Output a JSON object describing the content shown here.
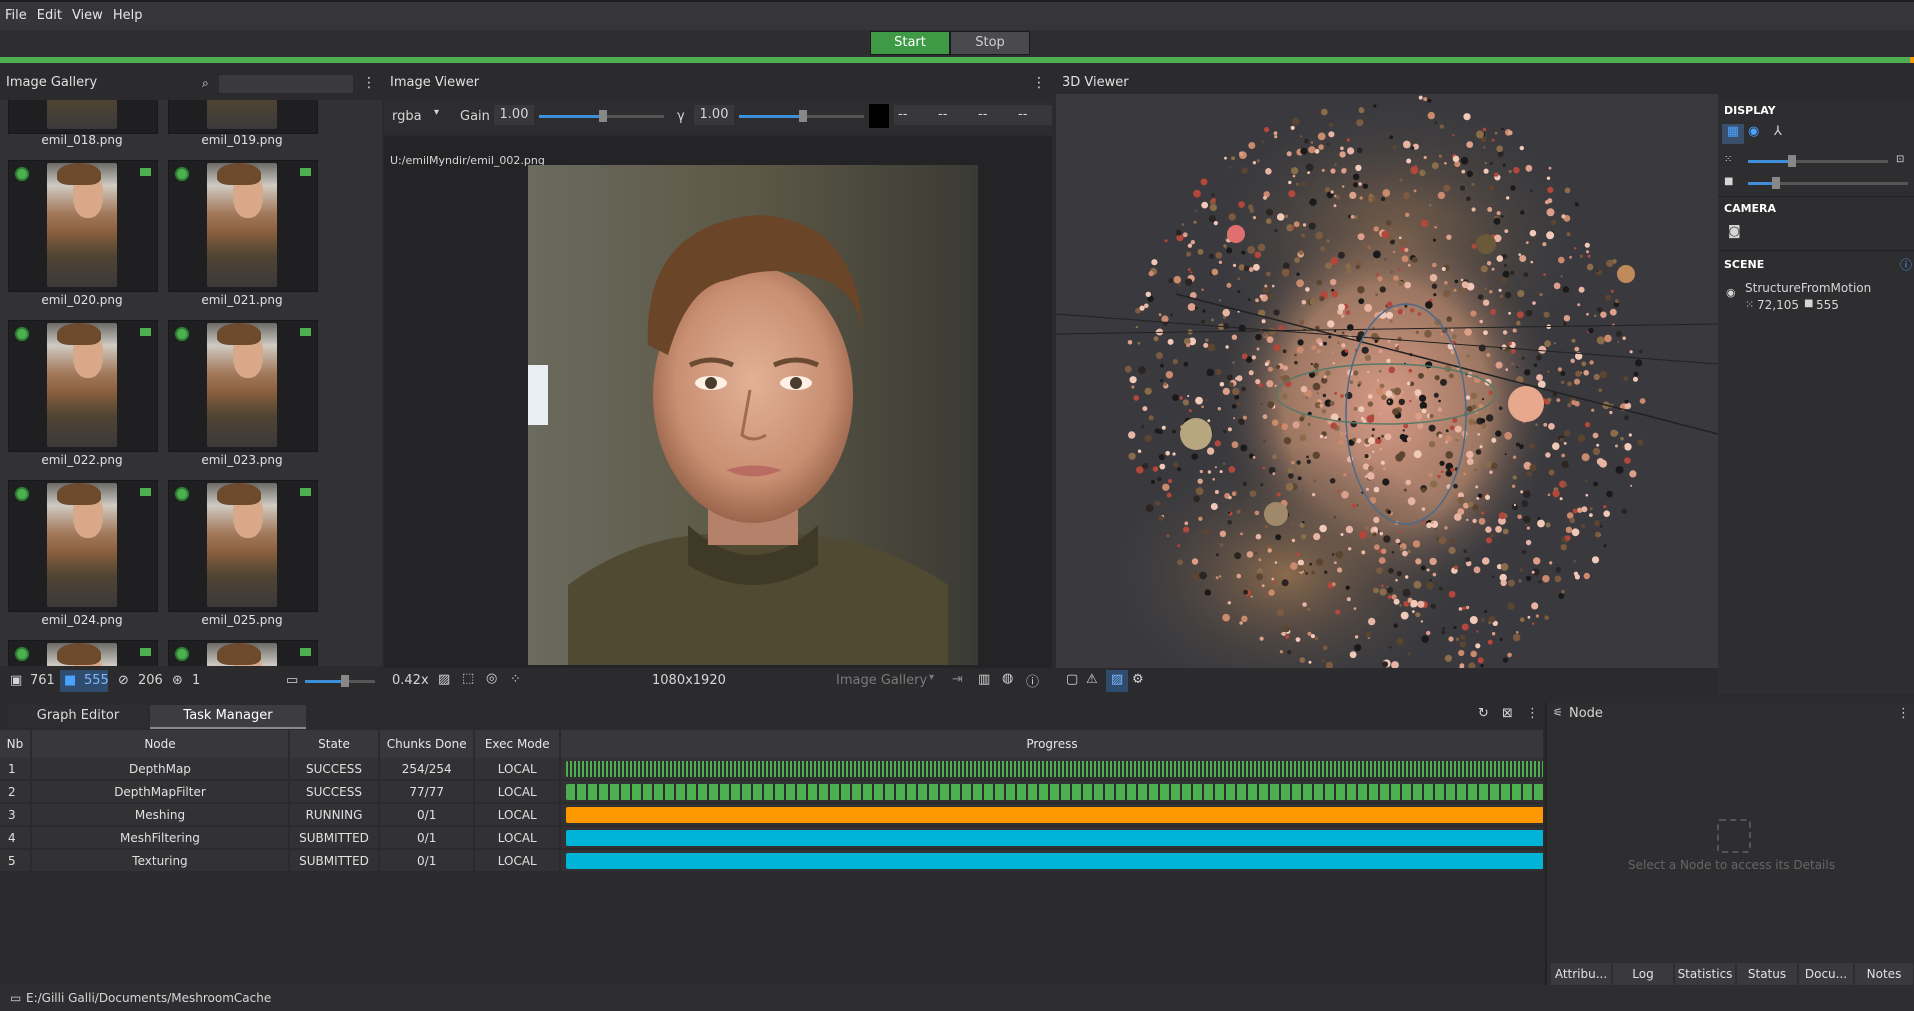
{
  "menu": {
    "items": [
      "File",
      "Edit",
      "View",
      "Help"
    ]
  },
  "run": {
    "start_label": "Start",
    "stop_label": "Stop"
  },
  "gallery": {
    "title": "Image Gallery",
    "search_placeholder": "",
    "items": [
      {
        "label": "emil_018.png"
      },
      {
        "label": "emil_019.png"
      },
      {
        "label": "emil_020.png"
      },
      {
        "label": "emil_021.png"
      },
      {
        "label": "emil_022.png"
      },
      {
        "label": "emil_023.png"
      },
      {
        "label": "emil_024.png"
      },
      {
        "label": "emil_025.png"
      }
    ],
    "footer": {
      "images": "761",
      "cameras": "555",
      "no_camera": "206",
      "intrinsics": "1"
    }
  },
  "viewer": {
    "title": "Image Viewer",
    "channel": "rgba",
    "gain_label": "Gain",
    "gain_value": "1.00",
    "gamma_label": "γ",
    "gamma_value": "1.00",
    "pixel_values": [
      "--",
      "--",
      "--",
      "--"
    ],
    "path": "U:/emilMyndir/emil_002.png",
    "zoom": "0.42x",
    "resolution": "1080x1920",
    "source": "Image Gallery"
  },
  "viewer3d": {
    "title": "3D Viewer",
    "display_title": "DISPLAY",
    "camera_title": "CAMERA",
    "scene_title": "SCENE",
    "scene_item": "StructureFromMotion",
    "points": "72,105",
    "cams": "555"
  },
  "task_manager": {
    "tabs": [
      "Graph Editor",
      "Task Manager"
    ],
    "columns": [
      "Nb",
      "Node",
      "State",
      "Chunks Done",
      "Exec Mode",
      "Progress"
    ],
    "rows": [
      {
        "nb": "1",
        "node": "DepthMap",
        "state": "SUCCESS",
        "chunks": "254/254",
        "mode": "LOCAL",
        "progress": 1.0,
        "color": "#4caf50",
        "style": "fine"
      },
      {
        "nb": "2",
        "node": "DepthMapFilter",
        "state": "SUCCESS",
        "chunks": "77/77",
        "mode": "LOCAL",
        "progress": 1.0,
        "color": "#4caf50",
        "style": "chunks"
      },
      {
        "nb": "3",
        "node": "Meshing",
        "state": "RUNNING",
        "chunks": "0/1",
        "mode": "LOCAL",
        "progress": 1.0,
        "color": "#ff9800",
        "style": "solid"
      },
      {
        "nb": "4",
        "node": "MeshFiltering",
        "state": "SUBMITTED",
        "chunks": "0/1",
        "mode": "LOCAL",
        "progress": 1.0,
        "color": "#00b4d8",
        "style": "solid"
      },
      {
        "nb": "5",
        "node": "Texturing",
        "state": "SUBMITTED",
        "chunks": "0/1",
        "mode": "LOCAL",
        "progress": 1.0,
        "color": "#00b4d8",
        "style": "solid"
      }
    ]
  },
  "node_panel": {
    "title": "Node",
    "hint": "Select a Node to access its Details",
    "tabs": [
      "Attribu...",
      "Log",
      "Statistics",
      "Status",
      "Docu...",
      "Notes"
    ]
  },
  "status": {
    "path": "E:/Gilli Galli/Documents/MeshroomCache"
  },
  "colors": {
    "accent": "#4caf50",
    "running": "#ff9800",
    "submitted": "#00b4d8",
    "slider": "#3c8fd8"
  }
}
